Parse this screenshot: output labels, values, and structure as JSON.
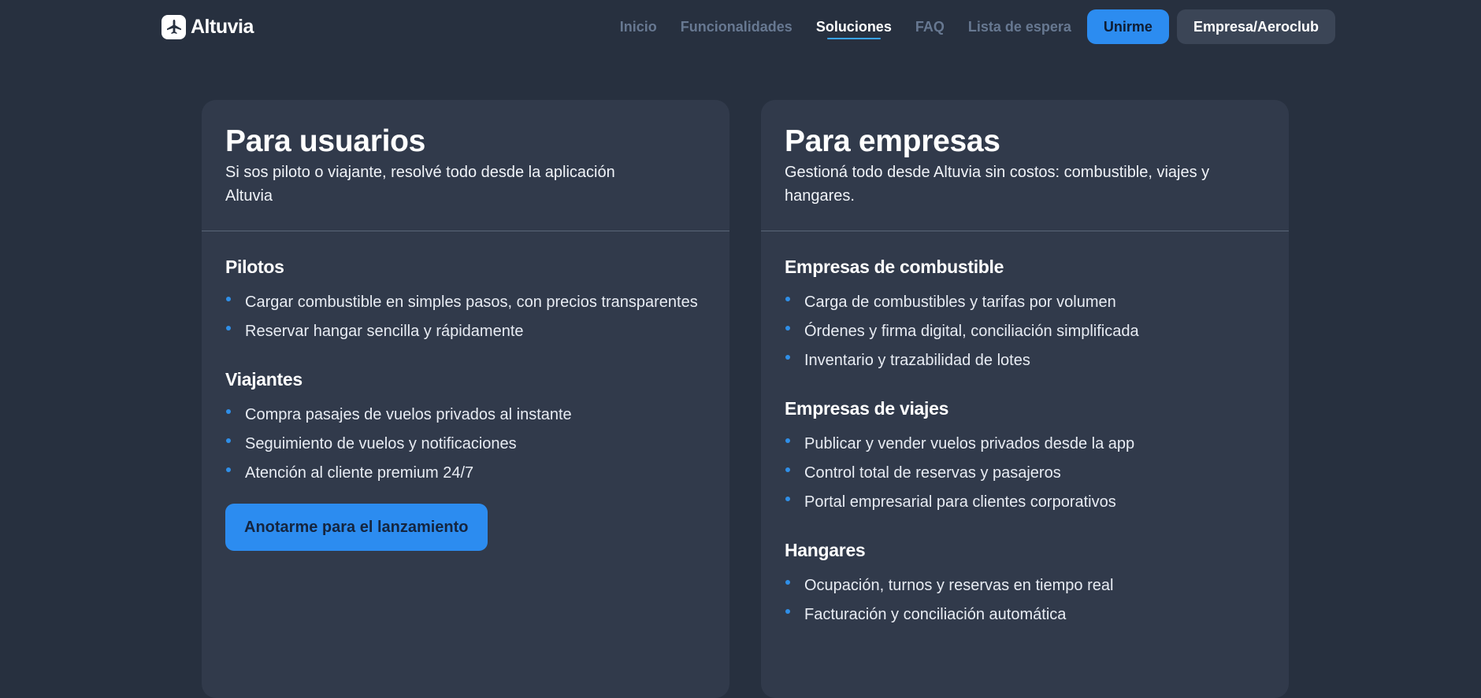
{
  "brand": {
    "name": "Altuvia"
  },
  "nav": {
    "links": [
      {
        "label": "Inicio"
      },
      {
        "label": "Funcionalidades"
      },
      {
        "label": "Soluciones"
      },
      {
        "label": "FAQ"
      },
      {
        "label": "Lista de espera"
      }
    ],
    "active": "Soluciones",
    "primary_button": "Unirme",
    "secondary_button": "Empresa/Aeroclub"
  },
  "users_card": {
    "title": "Para usuarios",
    "subtitle": "Si sos piloto o viajante, resolvé todo desde la aplicación Altuvia",
    "sections": [
      {
        "title": "Pilotos",
        "items": [
          "Cargar combustible en simples pasos, con precios transparentes",
          "Reservar hangar sencilla y rápidamente"
        ]
      },
      {
        "title": "Viajantes",
        "items": [
          "Compra pasajes de vuelos privados al instante",
          "Seguimiento de vuelos y notificaciones",
          "Atención al cliente premium 24/7"
        ]
      }
    ],
    "cta": "Anotarme para el lanzamiento"
  },
  "business_card": {
    "title": "Para empresas",
    "subtitle": "Gestioná todo desde Altuvia sin costos: combustible, viajes y hangares.",
    "sections": [
      {
        "title": "Empresas de combustible",
        "items": [
          "Carga de combustibles y tarifas por volumen",
          "Órdenes y firma digital, conciliación simplificada",
          "Inventario y trazabilidad de lotes"
        ]
      },
      {
        "title": "Empresas de viajes",
        "items": [
          "Publicar y vender vuelos privados desde la app",
          "Control total de reservas y pasajeros",
          "Portal empresarial para clientes corporativos"
        ]
      },
      {
        "title": "Hangares",
        "items": [
          "Ocupación, turnos y reservas en tiempo real",
          "Facturación y conciliación automática"
        ]
      }
    ]
  },
  "colors": {
    "background": "#27303f",
    "card": "#313a4b",
    "accent": "#2c8cf0",
    "nav_inactive": "#677891"
  }
}
